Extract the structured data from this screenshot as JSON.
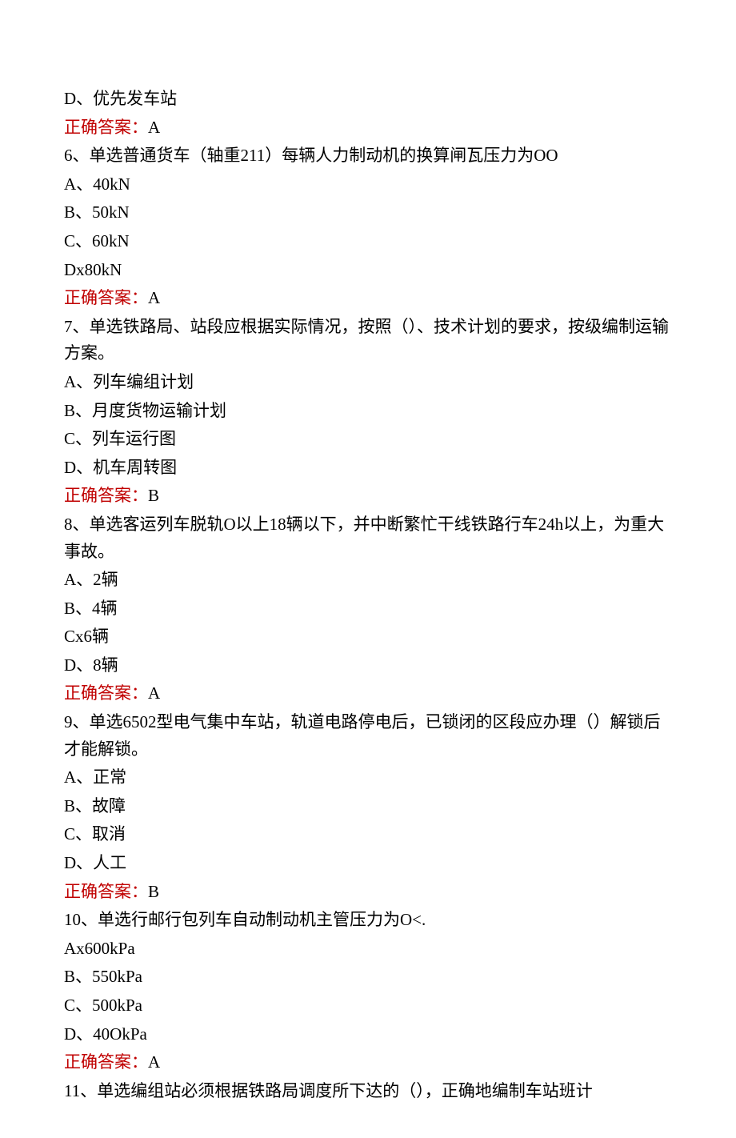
{
  "answer_label": "正确答案：",
  "questions": [
    {
      "pre_options": [
        "D、优先发车站"
      ],
      "answer": "A",
      "stem": "6、单选普通货车（轴重211）每辆人力制动机的换算闸瓦压力为OO",
      "options": [
        "A、40kN",
        "B、50kN",
        "C、60kN",
        "Dx80kN"
      ],
      "post_answer": "A"
    },
    {
      "stem": "7、单选铁路局、站段应根据实际情况，按照（）、技术计划的要求，按级编制运输方案。",
      "options": [
        "A、列车编组计划",
        "B、月度货物运输计划",
        "C、列车运行图",
        "D、机车周转图"
      ],
      "post_answer": "B"
    },
    {
      "stem": "8、单选客运列车脱轨O以上18辆以下，并中断繁忙干线铁路行车24h以上，为重大事故。",
      "options": [
        "A、2辆",
        "B、4辆",
        "Cx6辆",
        "D、8辆"
      ],
      "post_answer": "A"
    },
    {
      "stem": "9、单选6502型电气集中车站，轨道电路停电后，已锁闭的区段应办理（）解锁后才能解锁。",
      "options": [
        "A、正常",
        "B、故障",
        "C、取消",
        "D、人工"
      ],
      "post_answer": "B"
    },
    {
      "stem": "10、单选行邮行包列车自动制动机主管压力为O<.",
      "options": [
        "Ax600kPa",
        "B、550kPa",
        "C、500kPa",
        "D、40OkPa"
      ],
      "post_answer": "A"
    },
    {
      "stem": "11、单选编组站必须根据铁路局调度所下达的（），正确地编制车站班计",
      "options": [],
      "post_answer": null
    }
  ]
}
